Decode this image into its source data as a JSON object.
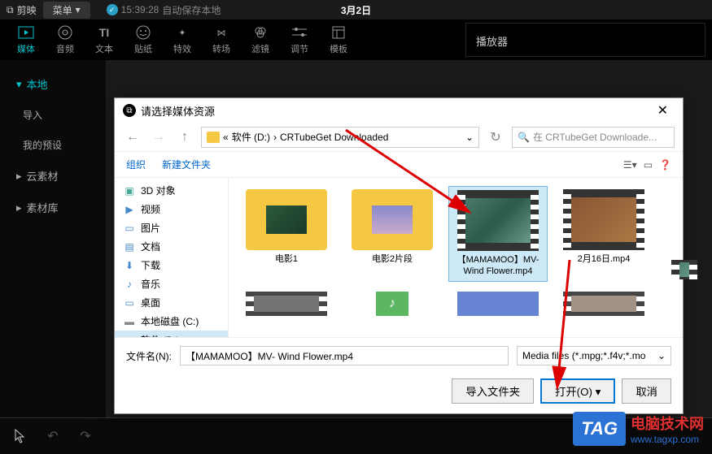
{
  "app": {
    "name": "剪映",
    "menu": "菜单",
    "autosave_time": "15:39:28",
    "autosave_text": "自动保存本地",
    "date": "3月2日"
  },
  "toolbar": {
    "items": [
      {
        "label": "媒体"
      },
      {
        "label": "音频"
      },
      {
        "label": "文本"
      },
      {
        "label": "贴纸"
      },
      {
        "label": "特效"
      },
      {
        "label": "转场"
      },
      {
        "label": "滤镜"
      },
      {
        "label": "调节"
      },
      {
        "label": "模板"
      }
    ]
  },
  "sidebar": {
    "items": [
      {
        "label": "本地",
        "active": true,
        "expandable": true
      },
      {
        "label": "导入",
        "sub": true
      },
      {
        "label": "我的预设",
        "sub": true
      },
      {
        "label": "云素材",
        "expandable": true
      },
      {
        "label": "素材库",
        "expandable": true
      }
    ]
  },
  "player": {
    "title": "播放器"
  },
  "dialog": {
    "title": "请选择媒体资源",
    "path_prefix": "«",
    "path_drive": "软件 (D:)",
    "path_folder": "CRTubeGet Downloaded",
    "search_placeholder": "在 CRTubeGet Downloade...",
    "organize": "组织",
    "new_folder": "新建文件夹",
    "tree": [
      {
        "label": "3D 对象",
        "icon": "cube"
      },
      {
        "label": "视频",
        "icon": "video"
      },
      {
        "label": "图片",
        "icon": "image"
      },
      {
        "label": "文档",
        "icon": "doc"
      },
      {
        "label": "下载",
        "icon": "download"
      },
      {
        "label": "音乐",
        "icon": "music"
      },
      {
        "label": "桌面",
        "icon": "desktop"
      },
      {
        "label": "本地磁盘 (C:)",
        "icon": "disk"
      },
      {
        "label": "软件 (D:)",
        "icon": "disk",
        "selected": true
      }
    ],
    "files": [
      {
        "name": "电影1",
        "type": "folder"
      },
      {
        "name": "电影2片段",
        "type": "folder"
      },
      {
        "name": "【MAMAMOO】MV- Wind Flower.mp4",
        "type": "video",
        "selected": true
      },
      {
        "name": "2月16日.mp4",
        "type": "video"
      }
    ],
    "filename_label": "文件名(N):",
    "filename_value": "【MAMAMOO】MV- Wind Flower.mp4",
    "filetype": "Media files (*.mpg;*.f4v;*.mo",
    "import_folder": "导入文件夹",
    "open": "打开(O)",
    "cancel": "取消"
  },
  "watermark": {
    "tag": "TAG",
    "title": "电脑技术网",
    "url": "www.tagxp.com"
  }
}
